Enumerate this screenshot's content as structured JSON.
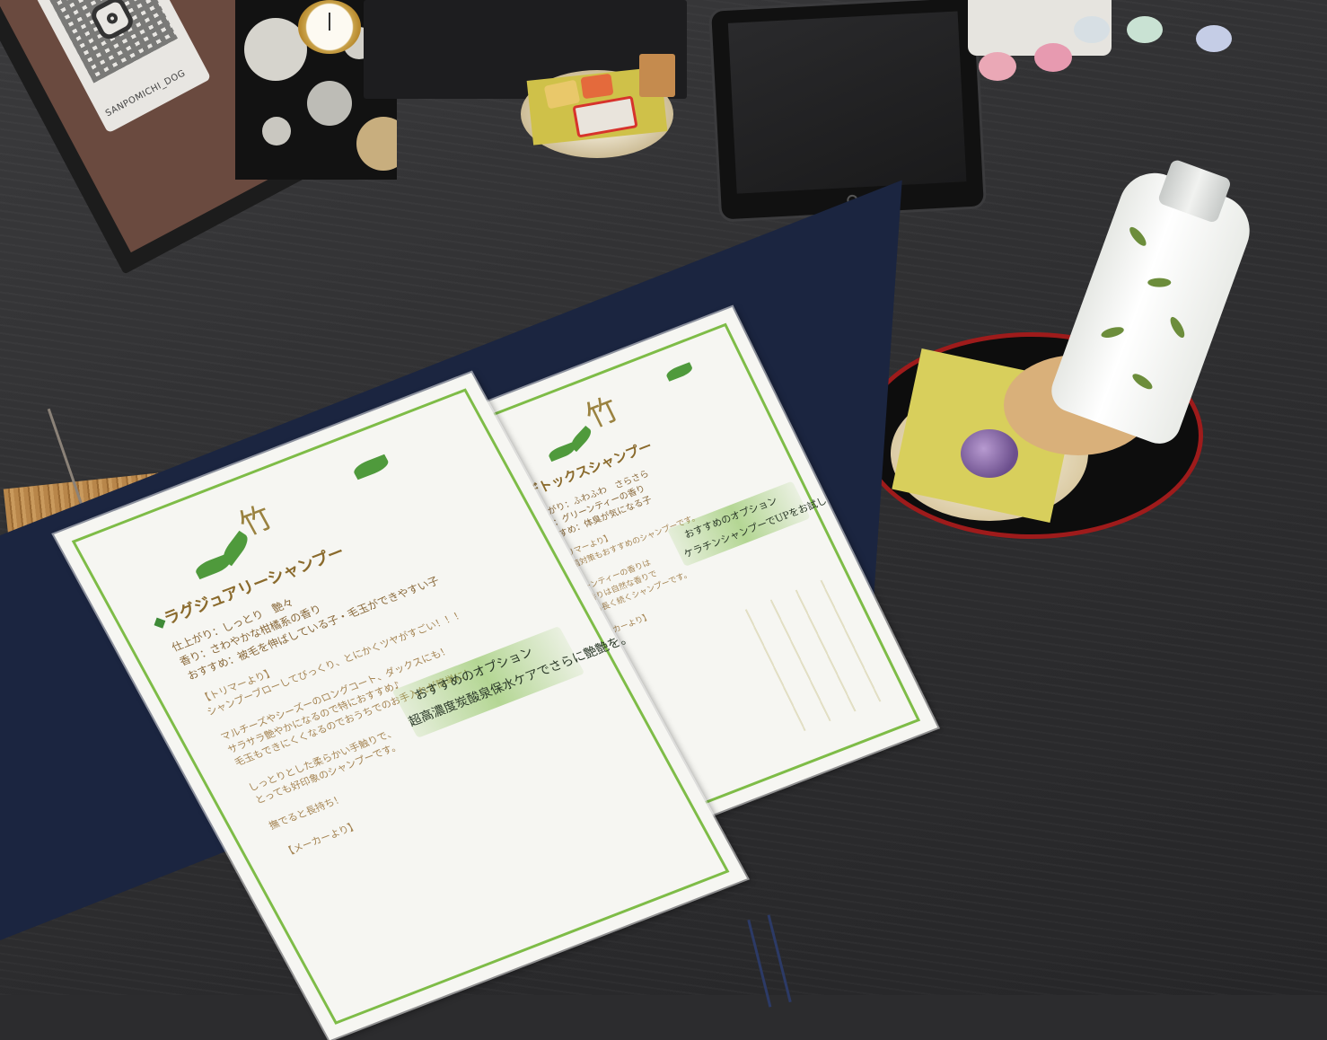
{
  "scene": {
    "qr_card": {
      "handle": "SANPOMICHI_DOG"
    },
    "menu": {
      "left_page": {
        "kanji": "竹",
        "title": "ラグジュアリーシャンプー",
        "specs": [
          {
            "label": "仕上がり",
            "value": "：しっとり　艶々"
          },
          {
            "label": "香り",
            "value": "：さわやかな柑橘系の香り"
          },
          {
            "label": "おすすめ",
            "value": "：被毛を伸ばしている子・毛玉ができやすい子"
          }
        ],
        "body": [
          "【トリマーより】",
          "シャンプーブローしてびっくり、とにかくツヤがすごい！！！",
          "マルチーズやシーズーのロングコート、ダックスにも！",
          "サラサラ艶やかになるので特におすすめ♪",
          "毛玉もできにくくなるのでおうちでのお手入れが簡単に！",
          "しっとりとした柔らかい手触りで、",
          "とっても好印象のシャンプーです。",
          "撫でると長持ち！",
          "【メーカーより】"
        ],
        "handwritten": [
          "おすすめのオプション",
          "超高濃度炭酸泉保水ケアでさらに艶艶を。"
        ]
      },
      "right_page": {
        "kanji": "竹",
        "title": "デトックスシャンプー",
        "specs": [
          {
            "label": "仕上がり",
            "value": "：ふわふわ　さらさら"
          },
          {
            "label": "香り",
            "value": "：グリーンティーの香り"
          },
          {
            "label": "おすすめ",
            "value": "：体臭が気になる子"
          }
        ],
        "body": [
          "【トリマーより】",
          "大腸菌対策もおすすめのシャンプーです。",
          "グリーンティーの香りは",
          "この香りは自然な香りで",
          "香りも長く続くシャンプーです。",
          "【メーカーより】"
        ],
        "handwritten": [
          "おすすめのオプション",
          "ケラチンシャンプーでUPをお試し"
        ]
      }
    }
  },
  "colors": {
    "table": "#2f2f31",
    "menu_green": "#7ebc47",
    "tray_red": "#9e1b1b",
    "folder_navy": "#1b2540"
  }
}
